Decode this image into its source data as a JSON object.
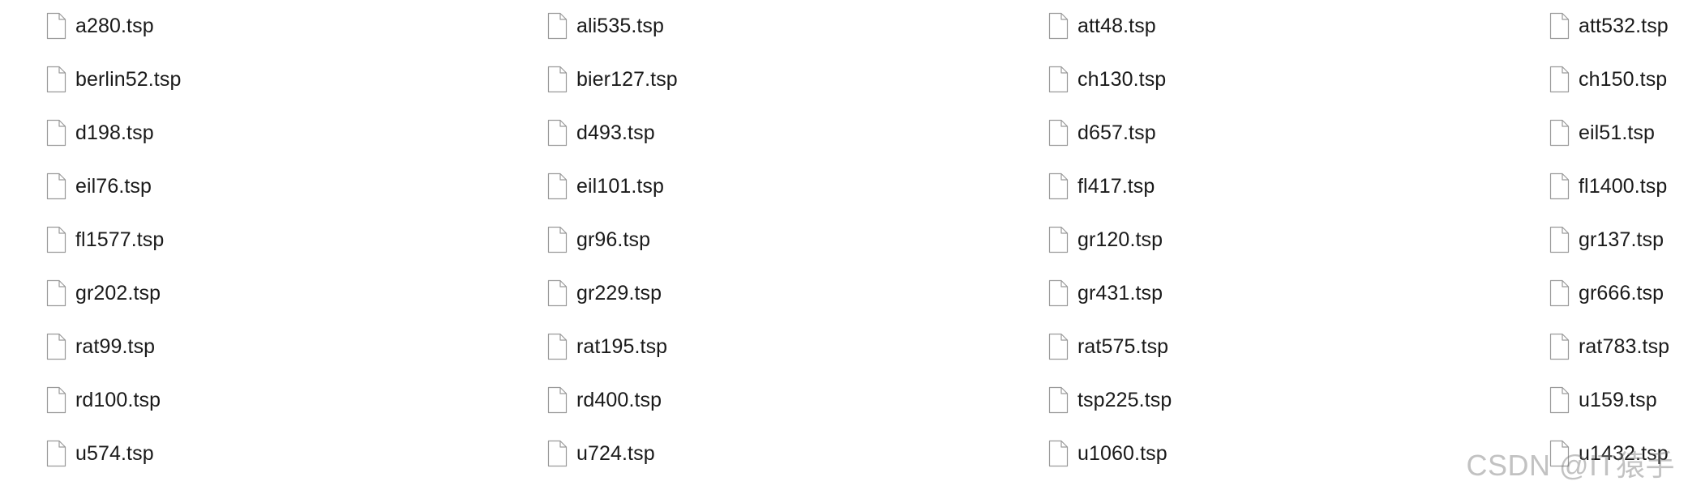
{
  "files": [
    {
      "name": "a280.tsp",
      "icon": "document-icon"
    },
    {
      "name": "ali535.tsp",
      "icon": "document-icon"
    },
    {
      "name": "att48.tsp",
      "icon": "document-icon"
    },
    {
      "name": "att532.tsp",
      "icon": "document-icon"
    },
    {
      "name": "berlin52.tsp",
      "icon": "document-icon"
    },
    {
      "name": "bier127.tsp",
      "icon": "document-icon"
    },
    {
      "name": "ch130.tsp",
      "icon": "document-icon"
    },
    {
      "name": "ch150.tsp",
      "icon": "document-icon"
    },
    {
      "name": "d198.tsp",
      "icon": "document-icon"
    },
    {
      "name": "d493.tsp",
      "icon": "document-icon"
    },
    {
      "name": "d657.tsp",
      "icon": "document-icon"
    },
    {
      "name": "eil51.tsp",
      "icon": "document-icon"
    },
    {
      "name": "eil76.tsp",
      "icon": "document-icon"
    },
    {
      "name": "eil101.tsp",
      "icon": "document-icon"
    },
    {
      "name": "fl417.tsp",
      "icon": "document-icon"
    },
    {
      "name": "fl1400.tsp",
      "icon": "document-icon"
    },
    {
      "name": "fl1577.tsp",
      "icon": "document-icon"
    },
    {
      "name": "gr96.tsp",
      "icon": "document-icon"
    },
    {
      "name": "gr120.tsp",
      "icon": "document-icon"
    },
    {
      "name": "gr137.tsp",
      "icon": "document-icon"
    },
    {
      "name": "gr202.tsp",
      "icon": "document-icon"
    },
    {
      "name": "gr229.tsp",
      "icon": "document-icon"
    },
    {
      "name": "gr431.tsp",
      "icon": "document-icon"
    },
    {
      "name": "gr666.tsp",
      "icon": "document-icon"
    },
    {
      "name": "rat99.tsp",
      "icon": "document-icon"
    },
    {
      "name": "rat195.tsp",
      "icon": "document-icon"
    },
    {
      "name": "rat575.tsp",
      "icon": "document-icon"
    },
    {
      "name": "rat783.tsp",
      "icon": "document-icon"
    },
    {
      "name": "rd100.tsp",
      "icon": "document-icon"
    },
    {
      "name": "rd400.tsp",
      "icon": "document-icon"
    },
    {
      "name": "tsp225.tsp",
      "icon": "document-icon"
    },
    {
      "name": "u159.tsp",
      "icon": "document-icon"
    },
    {
      "name": "u574.tsp",
      "icon": "document-icon"
    },
    {
      "name": "u724.tsp",
      "icon": "document-icon"
    },
    {
      "name": "u1060.tsp",
      "icon": "document-icon"
    },
    {
      "name": "u1432.tsp",
      "icon": "document-icon"
    }
  ],
  "watermark": "CSDN @IT猿手",
  "colors": {
    "text": "#1a1a1a",
    "icon_outline": "#9a9a9a",
    "icon_fill": "#ffffff",
    "background": "#ffffff"
  }
}
